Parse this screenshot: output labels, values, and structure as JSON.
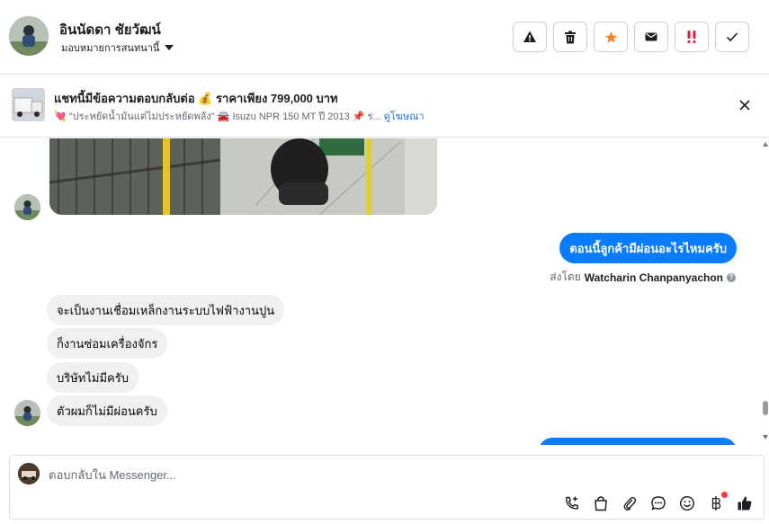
{
  "header": {
    "contact_name": "อินนัดดา ชัยวัฒน์",
    "assign_label": "มอบหมายการสนทนานี้",
    "actions": [
      {
        "name": "report-icon",
        "label": "spam"
      },
      {
        "name": "trash-icon",
        "label": "delete"
      },
      {
        "name": "star-icon",
        "label": "star"
      },
      {
        "name": "envelope-icon",
        "label": "unread"
      },
      {
        "name": "double-exclamation-icon",
        "label": "follow-up"
      },
      {
        "name": "check-icon",
        "label": "done"
      }
    ]
  },
  "ad": {
    "title": "แชทนี้มีข้อความตอบกลับต่อ 💰 ราคาเพียง 799,000 บาท",
    "subtitle": "💘 \"ประหยัดน้ำมันแต่ไม่ประหยัดพลัง\" 🚘 Isuzu NPR 150 MT ปี 2013 📌 ร...",
    "link": "ดูโฆษณา"
  },
  "thread": {
    "outgoing_1": "ตอนนี้ลูกค้ามีผ่อนอะไรไหมครับ",
    "sent_by_prefix": "ส่งโดย",
    "sent_by_name": "Watcharin Chanpanyachon",
    "sent_by_help": "?",
    "incoming": [
      "จะเป็นงานเชื่อมเหล็กงานระบบไฟฟ้างานปูน",
      "ก็งานซ่อมเครื่องจักร",
      "บริษัทไม่มีครับ",
      "ตัวผมก็ไม่มีผ่อนครับ"
    ]
  },
  "composer": {
    "placeholder": "ตอบกลับใน Messenger...",
    "tools": [
      "phone-plus-icon",
      "bag-icon",
      "paperclip-icon",
      "speech-dots-icon",
      "smiley-icon",
      "baht-icon",
      "thumbs-up-icon"
    ]
  },
  "colors": {
    "accent": "#0a7cff",
    "star": "#f5822a",
    "alert": "#e41e3f",
    "incoming_bubble": "#f0f0f0"
  }
}
